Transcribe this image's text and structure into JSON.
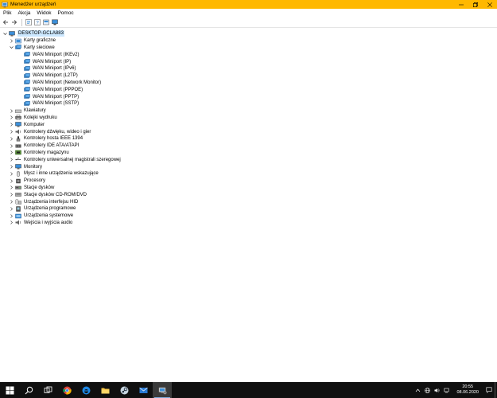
{
  "window": {
    "title": "Menedżer urządzeń",
    "accent": "#ffb800"
  },
  "menu": [
    "Plik",
    "Akcja",
    "Widok",
    "Pomoc"
  ],
  "toolbar": [
    "back-icon",
    "forward-icon",
    "properties-icon",
    "help-icon",
    "update-driver-icon",
    "monitor-icon"
  ],
  "tree": {
    "root": "DESKTOP-GCLA883",
    "items": [
      {
        "label": "Karty graficzne",
        "icon": "display-adapter-icon",
        "expanded": false
      },
      {
        "label": "Karty sieciowe",
        "icon": "network-adapter-icon",
        "expanded": true,
        "children": [
          "WAN Miniport (IKEv2)",
          "WAN Miniport (IP)",
          "WAN Miniport (IPv6)",
          "WAN Miniport (L2TP)",
          "WAN Miniport (Network Monitor)",
          "WAN Miniport (PPPOE)",
          "WAN Miniport (PPTP)",
          "WAN Miniport (SSTP)"
        ]
      },
      {
        "label": "Klawiatury",
        "icon": "keyboard-icon",
        "expanded": false
      },
      {
        "label": "Kolejki wydruku",
        "icon": "printer-icon",
        "expanded": false
      },
      {
        "label": "Komputer",
        "icon": "computer-icon",
        "expanded": false
      },
      {
        "label": "Kontrolery dźwięku, wideo i gier",
        "icon": "speaker-icon",
        "expanded": false
      },
      {
        "label": "Kontrolery hosta IEEE 1394",
        "icon": "ieee1394-icon",
        "expanded": false
      },
      {
        "label": "Kontrolery IDE ATA/ATAPI",
        "icon": "ide-controller-icon",
        "expanded": false
      },
      {
        "label": "Kontrolery magazynu",
        "icon": "storage-controller-icon",
        "expanded": false
      },
      {
        "label": "Kontrolery uniwersalnej magistrali szeregowej",
        "icon": "usb-icon",
        "expanded": false
      },
      {
        "label": "Monitory",
        "icon": "monitor-icon",
        "expanded": false
      },
      {
        "label": "Mysz i inne urządzenia wskazujące",
        "icon": "mouse-icon",
        "expanded": false
      },
      {
        "label": "Procesory",
        "icon": "processor-icon",
        "expanded": false
      },
      {
        "label": "Stacje dysków",
        "icon": "disk-drive-icon",
        "expanded": false
      },
      {
        "label": "Stacje dysków CD-ROM/DVD",
        "icon": "cdrom-icon",
        "expanded": false
      },
      {
        "label": "Urządzenia interfejsu HID",
        "icon": "hid-icon",
        "expanded": false
      },
      {
        "label": "Urządzenia programowe",
        "icon": "software-device-icon",
        "expanded": false
      },
      {
        "label": "Urządzenia systemowe",
        "icon": "system-device-icon",
        "expanded": false
      },
      {
        "label": "Wejścia i wyjścia audio",
        "icon": "audio-io-icon",
        "expanded": false
      }
    ]
  },
  "taskbar": {
    "apps": [
      "windows-start-icon",
      "search-icon",
      "task-view-icon",
      "chrome-icon",
      "edge-icon",
      "file-explorer-icon",
      "steam-icon",
      "mail-icon",
      "device-manager-icon"
    ],
    "tray": [
      "chevron-up-icon",
      "network-icon",
      "volume-icon",
      "speaker-system-icon"
    ],
    "time": "20:55",
    "date": "08.06.2020"
  }
}
